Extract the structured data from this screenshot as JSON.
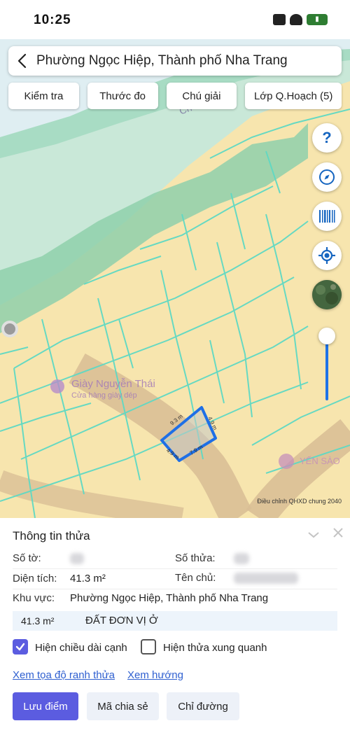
{
  "status_bar": {
    "time": "10:25"
  },
  "header": {
    "title": "Phường Ngọc Hiệp, Thành phố Nha Trang"
  },
  "toolbar": {
    "items": [
      {
        "label": "Kiểm tra"
      },
      {
        "label": "Thước đo"
      },
      {
        "label": "Chú giải"
      },
      {
        "label": "Lớp Q.Hoạch (5)"
      }
    ]
  },
  "map": {
    "poi_shop_name": "Giày Nguyễn Thái",
    "poi_shop_sub": "Cửa hàng giày dép",
    "poi_right": "YẾN SÀO",
    "map_text": "Ch",
    "parcel_edges": [
      "9.3 m",
      "4.9 m",
      "7.9 m",
      "4.9 m"
    ],
    "plan_note": "Điều chỉnh QHXD chung 2040",
    "help_symbol": "?",
    "colors": {
      "land": "#f7e5ae",
      "river": "#c9e8d8",
      "road": "#d9bf96",
      "parcel_lines": "#5fd9c4",
      "parcel_outline": "#1e6fe6"
    }
  },
  "panel": {
    "title": "Thông tin thửa",
    "so_to_label": "Số tờ:",
    "so_thua_label": "Số thửa:",
    "dien_tich_label": "Diện tích:",
    "dien_tich_value": "41.3 m²",
    "ten_chu_label": "Tên chủ:",
    "khu_vuc_label": "Khu vực:",
    "khu_vuc_value": "Phường Ngọc Hiệp, Thành phố Nha Trang",
    "land_area": "41.3 m²",
    "land_type": "ĐẤT ĐƠN VỊ Ở",
    "checkbox_edges_label": "Hiện chiều dài cạnh",
    "checkbox_edges_checked": true,
    "checkbox_neighbors_label": "Hiện thửa xung quanh",
    "checkbox_neighbors_checked": false,
    "link_coords": "Xem tọa độ ranh thửa",
    "link_direction": "Xem hướng",
    "btn_save": "Lưu điểm",
    "btn_share": "Mã chia sẻ",
    "btn_route": "Chỉ đường",
    "accent": "#5b5ce0"
  }
}
